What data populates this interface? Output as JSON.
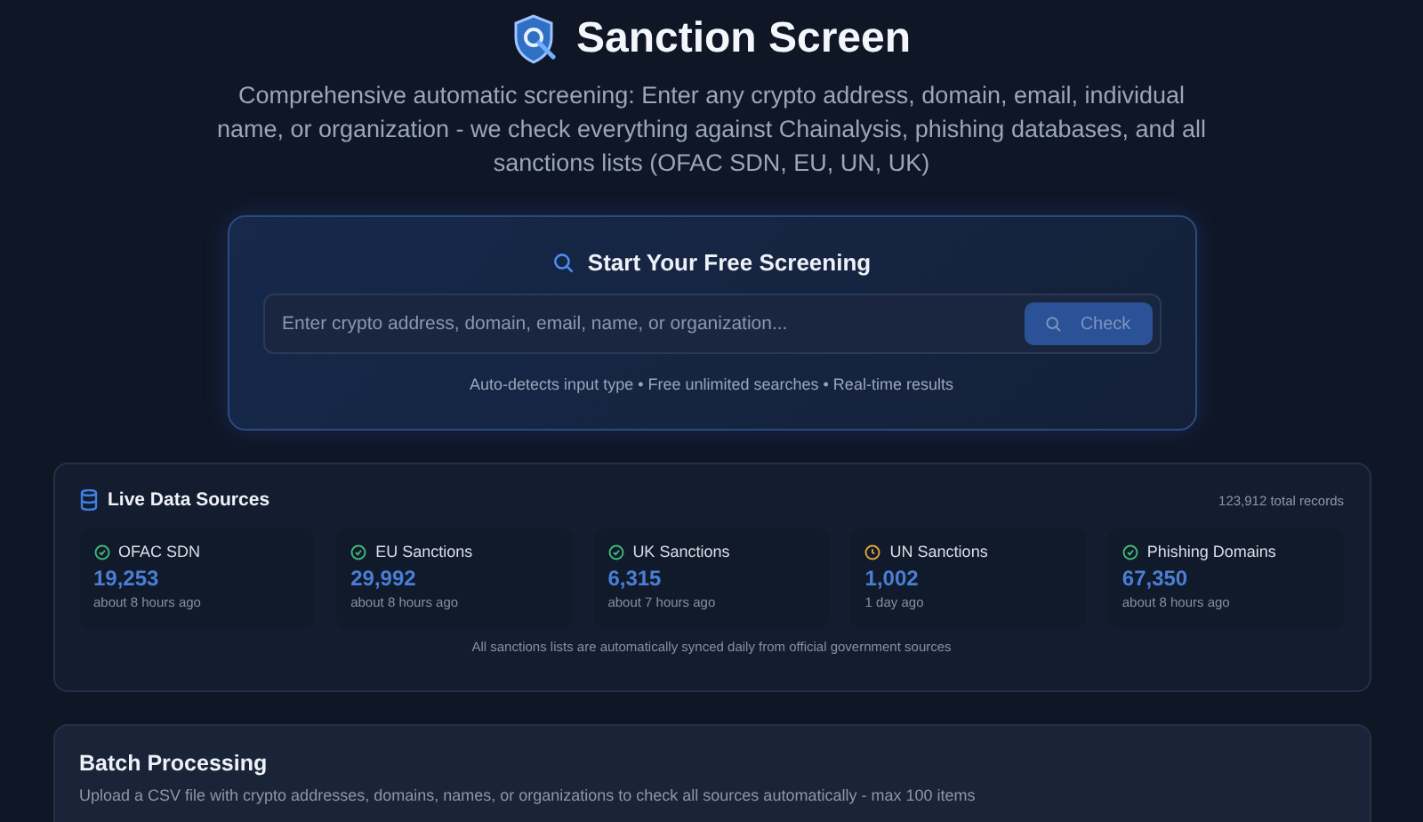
{
  "header": {
    "title": "Sanction Screen",
    "subtitle": "Comprehensive automatic screening: Enter any crypto address, domain, email, individual name, or organization - we check everything against Chainalysis, phishing databases, and all sanctions lists (OFAC SDN, EU, UN, UK)"
  },
  "screening": {
    "title": "Start Your Free Screening",
    "search": {
      "placeholder": "Enter crypto address, domain, email, name, or organization..."
    },
    "button": "Check",
    "hint": "Auto-detects input type • Free unlimited searches • Real-time results"
  },
  "data_sources": {
    "title": "Live Data Sources",
    "total": "123,912 total records",
    "sources": [
      {
        "name": "OFAC SDN",
        "count": "19,253",
        "updated": "about 8 hours ago",
        "kind": "synced"
      },
      {
        "name": "EU Sanctions",
        "count": "29,992",
        "updated": "about 8 hours ago",
        "kind": "synced"
      },
      {
        "name": "UK Sanctions",
        "count": "6,315",
        "updated": "about 7 hours ago",
        "kind": "synced"
      },
      {
        "name": "UN Sanctions",
        "count": "1,002",
        "updated": "1 day ago",
        "kind": "pending"
      },
      {
        "name": "Phishing Domains",
        "count": "67,350",
        "updated": "about 8 hours ago",
        "kind": "synced"
      }
    ],
    "footnote": "All sanctions lists are automatically synced daily from official government sources"
  },
  "batch": {
    "title": "Batch Processing",
    "description": "Upload a CSV file with crypto addresses, domains, names, or organizations to check all sources automatically - max 100 items"
  }
}
